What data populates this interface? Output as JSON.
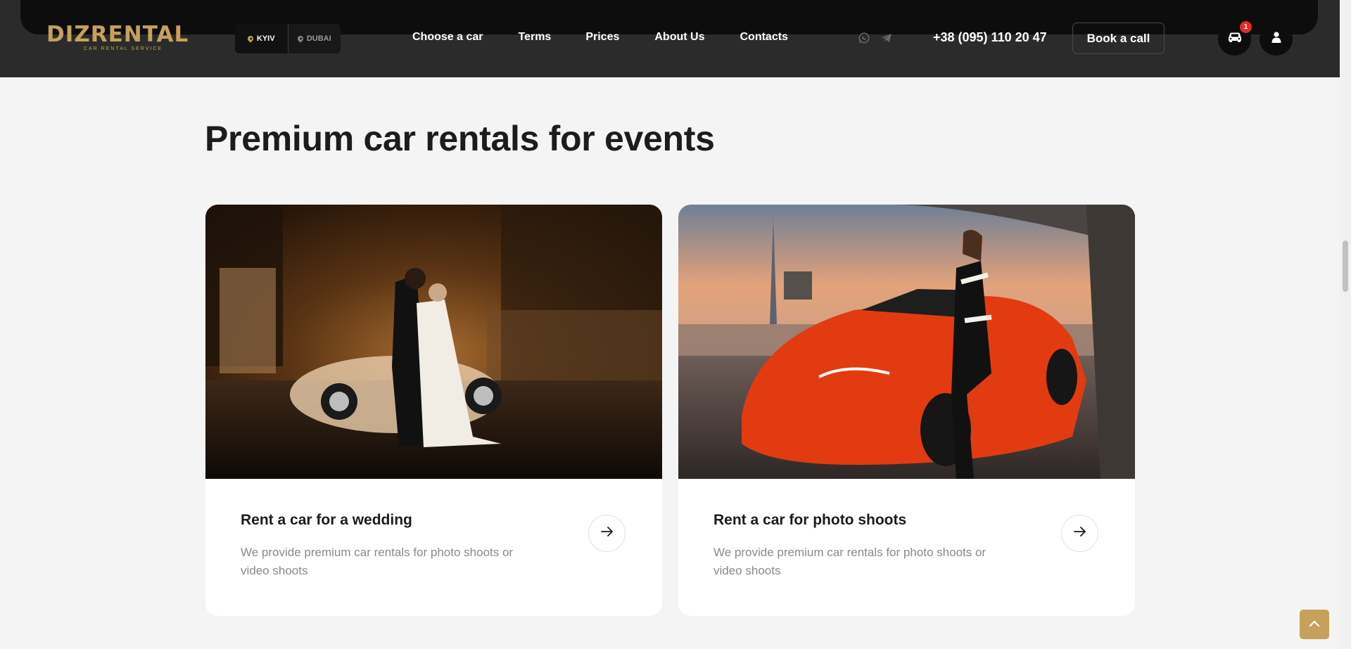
{
  "header": {
    "logo": {
      "name": "DIZRENTAL",
      "tagline": "CAR RENTAL SERVICE"
    },
    "cities": [
      {
        "label": "KYIV",
        "active": true
      },
      {
        "label": "DUBAI",
        "active": false
      }
    ],
    "nav": [
      "Choose a car",
      "Terms",
      "Prices",
      "About Us",
      "Contacts"
    ],
    "social": [
      "whatsapp-icon",
      "telegram-icon"
    ],
    "phone": "+38 (095) 110 20 47",
    "book_label": "Book a call",
    "cart_count": "1"
  },
  "main": {
    "title": "Premium car rentals for events",
    "cards": [
      {
        "title": "Rent a car for a wedding",
        "description": "We provide premium car rentals for photo shoots or video shoots",
        "image": "wedding couple kissing beside vintage beetle car in rain at night"
      },
      {
        "title": "Rent a car for photo shoots",
        "description": "We provide premium car rentals for photo shoots or video shoots",
        "image": "woman leaning on red sports car under overpass at sunset"
      }
    ]
  },
  "colors": {
    "accent": "#c6a15b",
    "header_bg": "#2b2b2b",
    "page_bg": "#f4f4f4",
    "badge": "#e22b2b"
  }
}
